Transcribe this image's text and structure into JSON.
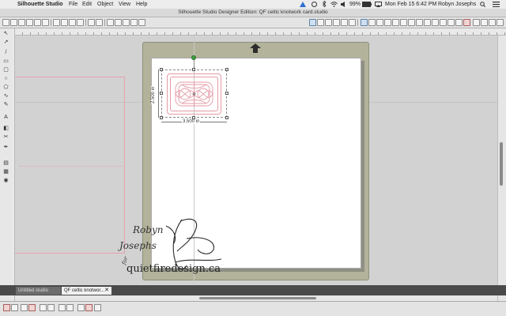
{
  "menubar": {
    "app_name": "Silhouette Studio",
    "items": [
      "File",
      "Edit",
      "Object",
      "View",
      "Help"
    ],
    "battery": "99%",
    "datetime": "Mon Feb 15  6:42 PM",
    "user": "Robyn Josephs"
  },
  "window": {
    "title": "Silhouette Studio Designer Edition: QF celtic knotwork card.studio"
  },
  "selection": {
    "width_label": "3.500 in",
    "height_label": "2.500 in"
  },
  "watermark": {
    "line1": "Robyn",
    "line2": "Josephs",
    "line3": "for",
    "site": "quietfiredesign.ca"
  },
  "tabs": {
    "items": [
      {
        "label": "Untitled studio"
      },
      {
        "label": "QF celtic knotwor..."
      }
    ],
    "close_glyph": "✕"
  },
  "icons": {
    "apple": "",
    "mat_arrow": "up-arrow-icon"
  },
  "colors": {
    "cut_line": "#e49aa6",
    "mat": "#b3b39b",
    "rotate_handle": "#3fa03f"
  }
}
